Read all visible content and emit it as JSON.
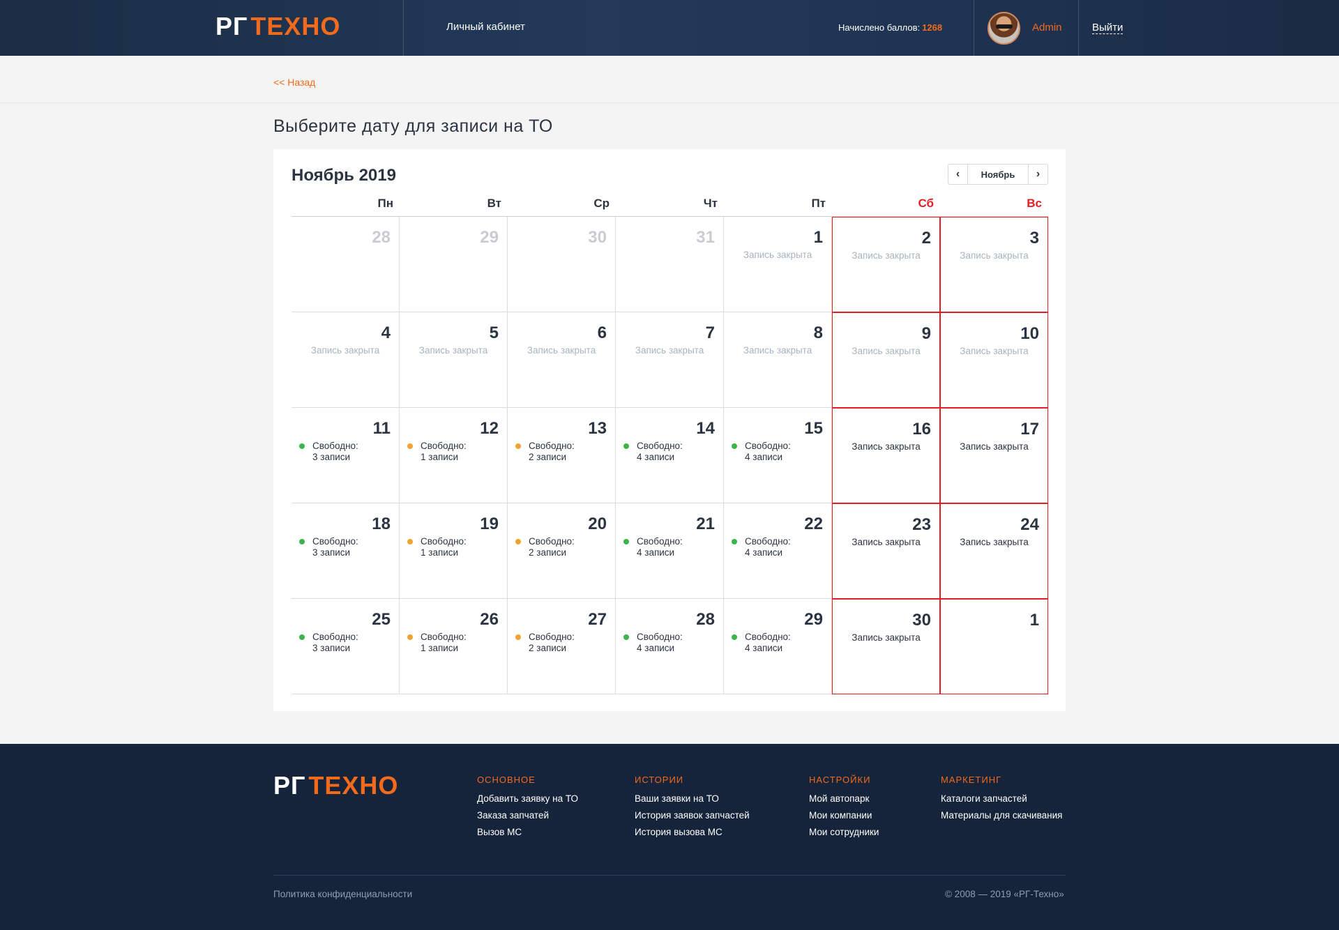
{
  "header": {
    "logo": {
      "part1": "РГ",
      "part2": "ТЕХНО"
    },
    "cabinet_label": "Личный кабинет",
    "points_label": "Начислено баллов:",
    "points_value": "1268",
    "user_name": "Admin",
    "logout_label": "Выйти"
  },
  "back_label": "<< Назад",
  "page_title": "Выберите дату для записи на ТО",
  "calendar": {
    "month_title": "Ноябрь 2019",
    "switch_label": "Ноябрь",
    "weekdays": [
      "Пн",
      "Вт",
      "Ср",
      "Чт",
      "Пт",
      "Сб",
      "Вс"
    ],
    "closed_label": "Запись закрыта",
    "free_label": "Свободно:",
    "colors": {
      "green": "#3cb44b",
      "orange": "#f0a42f",
      "weekend": "#e31e24"
    },
    "weeks": [
      [
        {
          "day": "28",
          "other": true
        },
        {
          "day": "29",
          "other": true
        },
        {
          "day": "30",
          "other": true
        },
        {
          "day": "31",
          "other": true
        },
        {
          "day": "1",
          "status": "closed"
        },
        {
          "day": "2",
          "status": "closed"
        },
        {
          "day": "3",
          "status": "closed"
        }
      ],
      [
        {
          "day": "4",
          "status": "closed"
        },
        {
          "day": "5",
          "status": "closed"
        },
        {
          "day": "6",
          "status": "closed"
        },
        {
          "day": "7",
          "status": "closed"
        },
        {
          "day": "8",
          "status": "closed"
        },
        {
          "day": "9",
          "status": "closed"
        },
        {
          "day": "10",
          "status": "closed"
        }
      ],
      [
        {
          "day": "11",
          "status": "free",
          "slots": "3 записи",
          "dot": "green"
        },
        {
          "day": "12",
          "status": "free",
          "slots": "1 записи",
          "dot": "orange"
        },
        {
          "day": "13",
          "status": "free",
          "slots": "2 записи",
          "dot": "orange"
        },
        {
          "day": "14",
          "status": "free",
          "slots": "4 записи",
          "dot": "green"
        },
        {
          "day": "15",
          "status": "free",
          "slots": "4 записи",
          "dot": "green"
        },
        {
          "day": "16",
          "status": "closed_dark"
        },
        {
          "day": "17",
          "status": "closed_dark"
        }
      ],
      [
        {
          "day": "18",
          "status": "free",
          "slots": "3 записи",
          "dot": "green"
        },
        {
          "day": "19",
          "status": "free",
          "slots": "1 записи",
          "dot": "orange"
        },
        {
          "day": "20",
          "status": "free",
          "slots": "2 записи",
          "dot": "orange"
        },
        {
          "day": "21",
          "status": "free",
          "slots": "4 записи",
          "dot": "green"
        },
        {
          "day": "22",
          "status": "free",
          "slots": "4 записи",
          "dot": "green"
        },
        {
          "day": "23",
          "status": "closed_dark"
        },
        {
          "day": "24",
          "status": "closed_dark"
        }
      ],
      [
        {
          "day": "25",
          "status": "free",
          "slots": "3 записи",
          "dot": "green"
        },
        {
          "day": "26",
          "status": "free",
          "slots": "1 записи",
          "dot": "orange"
        },
        {
          "day": "27",
          "status": "free",
          "slots": "2 записи",
          "dot": "orange"
        },
        {
          "day": "28",
          "status": "free",
          "slots": "4 записи",
          "dot": "green"
        },
        {
          "day": "29",
          "status": "free",
          "slots": "4 записи",
          "dot": "green"
        },
        {
          "day": "30",
          "status": "closed_dark"
        },
        {
          "day": "1",
          "status": "none"
        }
      ]
    ]
  },
  "footer": {
    "logo": {
      "part1": "РГ",
      "part2": "ТЕХНО"
    },
    "columns": [
      {
        "title": "ОСНОВНОЕ",
        "links": [
          "Добавить заявку на ТО",
          "Заказа запчатей",
          "Вызов МС"
        ]
      },
      {
        "title": "ИСТОРИИ",
        "links": [
          "Ваши заявки на ТО",
          "История заявок запчастей",
          "История вызова МС"
        ]
      },
      {
        "title": "НАСТРОЙКИ",
        "links": [
          "Мой автопарк",
          "Мои компании",
          "Мои сотрудники"
        ]
      },
      {
        "title": "МАРКЕТИНГ",
        "links": [
          "Каталоги запчастей",
          "Материалы для скачивания"
        ]
      }
    ],
    "privacy": "Политика конфиденциальности",
    "copyright": "© 2008 — 2019 «РГ-Техно»"
  }
}
